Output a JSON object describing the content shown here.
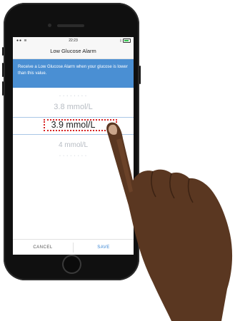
{
  "status_bar": {
    "time": "22:23",
    "signal_icon": "signal-dots-icon",
    "wifi_icon": "wifi-icon",
    "bluetooth_icon": "bluetooth-icon",
    "battery_icon": "battery-icon",
    "battery_color": "#2ec24b"
  },
  "header": {
    "title": "Low Glucose Alarm"
  },
  "banner": {
    "text": "Receive a Low Glucose Alarm when your glucose is lower than this value.",
    "color": "#4a8fd3"
  },
  "picker": {
    "above": "3.8 mmol/L",
    "selected": "3.9 mmol/L",
    "below": "4 mmol/L",
    "highlight_color": "#d72323"
  },
  "footer": {
    "cancel_label": "CANCEL",
    "save_label": "SAVE",
    "save_color": "#2f7fd2"
  }
}
